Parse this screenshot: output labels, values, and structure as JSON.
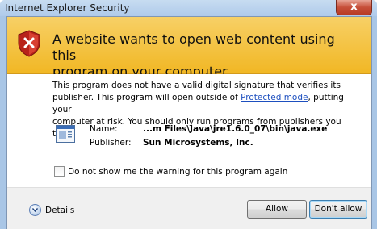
{
  "window": {
    "title": "Internet Explorer Security",
    "close_label": "x"
  },
  "banner": {
    "icon": "shield-warning-icon",
    "headline_line1": "A website wants to open web content using this",
    "headline_line2": "program on your computer"
  },
  "warning": {
    "line1": "This program does not have a valid digital signature that verifies its",
    "line2_before": "publisher. This program will open outside of ",
    "link": "Protected mode",
    "line2_after": ", putting your",
    "line3": "computer at risk. You should only run programs from publishers you trust."
  },
  "program": {
    "icon": "application-icon",
    "name_label": "Name:",
    "name_value": "...m Files\\Java\\jre1.6.0_07\\bin\\java.exe",
    "publisher_label": "Publisher:",
    "publisher_value": "Sun Microsystems, Inc."
  },
  "checkbox": {
    "label": "Do not show me the warning for this program again",
    "checked": false
  },
  "footer": {
    "details_label": "Details",
    "allow_label": "Allow",
    "dont_allow_label": "Don't allow"
  },
  "colors": {
    "banner": "#f3c23a",
    "shield_red": "#c0281e",
    "link": "#1d4fbf"
  }
}
